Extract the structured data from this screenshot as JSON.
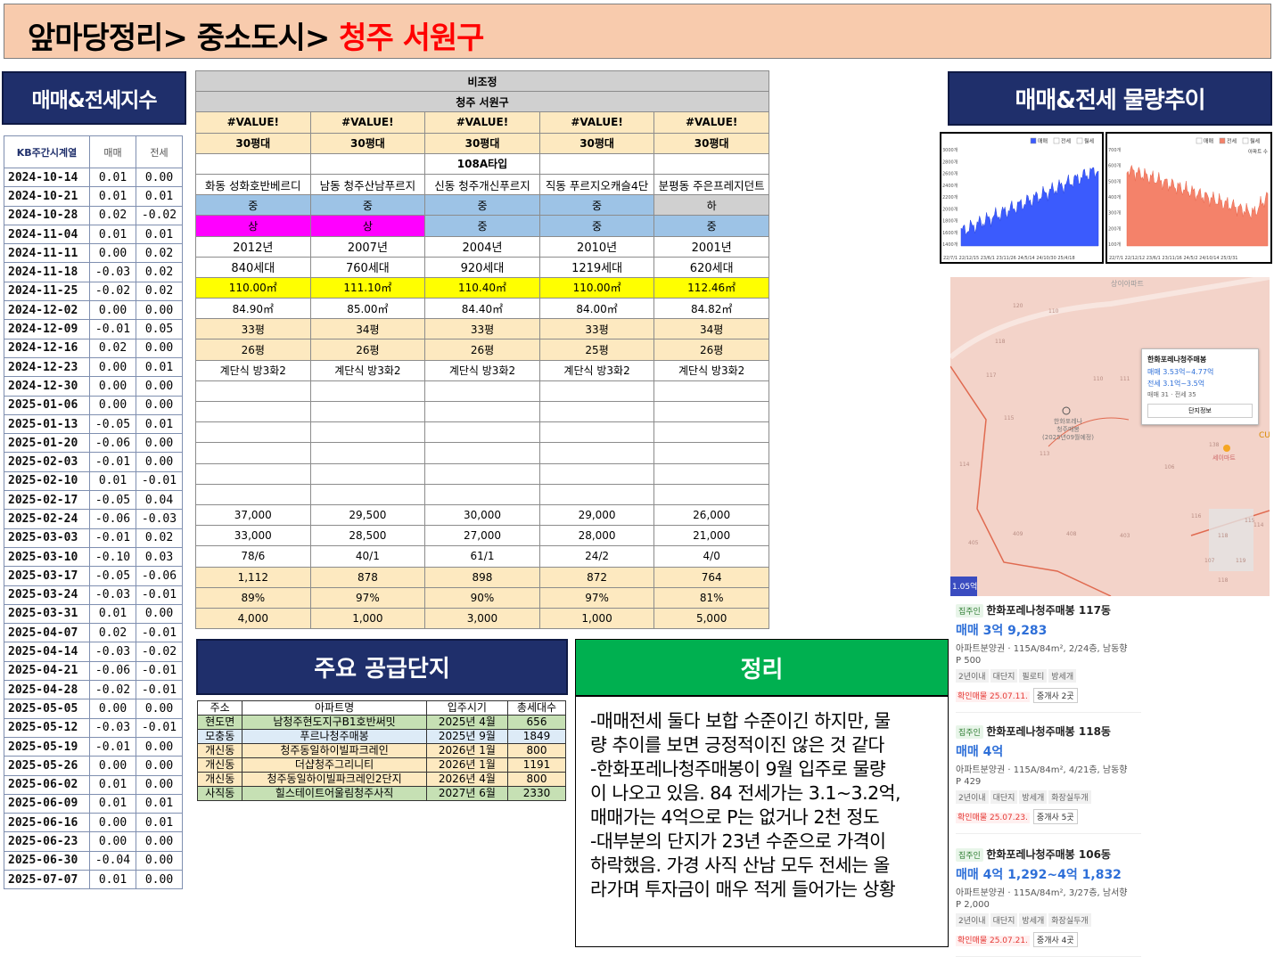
{
  "title": {
    "prefix": "앞마당정리> 중소도시> ",
    "region": "청주 서원구"
  },
  "kb": {
    "header": "매매&전세지수",
    "col_date": "KB주간시계열",
    "col_sale": "매매",
    "col_jeonse": "전세",
    "rows": [
      [
        "2024-10-14",
        "0.01",
        "0.00"
      ],
      [
        "2024-10-21",
        "0.01",
        "0.01"
      ],
      [
        "2024-10-28",
        "0.02",
        "-0.02"
      ],
      [
        "2024-11-04",
        "0.01",
        "0.01"
      ],
      [
        "2024-11-11",
        "0.00",
        "0.02"
      ],
      [
        "2024-11-18",
        "-0.03",
        "0.02"
      ],
      [
        "2024-11-25",
        "-0.02",
        "0.02"
      ],
      [
        "2024-12-02",
        "0.00",
        "0.00"
      ],
      [
        "2024-12-09",
        "-0.01",
        "0.05"
      ],
      [
        "2024-12-16",
        "0.02",
        "0.00"
      ],
      [
        "2024-12-23",
        "0.00",
        "0.01"
      ],
      [
        "2024-12-30",
        "0.00",
        "0.00"
      ],
      [
        "2025-01-06",
        "0.00",
        "0.00"
      ],
      [
        "2025-01-13",
        "-0.05",
        "0.01"
      ],
      [
        "2025-01-20",
        "-0.06",
        "0.00"
      ],
      [
        "2025-02-03",
        "-0.01",
        "0.00"
      ],
      [
        "2025-02-10",
        "0.01",
        "-0.01"
      ],
      [
        "2025-02-17",
        "-0.05",
        "0.04"
      ],
      [
        "2025-02-24",
        "-0.06",
        "-0.03"
      ],
      [
        "2025-03-03",
        "-0.01",
        "0.02"
      ],
      [
        "2025-03-10",
        "-0.10",
        "0.03"
      ],
      [
        "2025-03-17",
        "-0.05",
        "-0.06"
      ],
      [
        "2025-03-24",
        "-0.03",
        "-0.01"
      ],
      [
        "2025-03-31",
        "0.01",
        "0.00"
      ],
      [
        "2025-04-07",
        "0.02",
        "-0.01"
      ],
      [
        "2025-04-14",
        "-0.03",
        "-0.02"
      ],
      [
        "2025-04-21",
        "-0.06",
        "-0.01"
      ],
      [
        "2025-04-28",
        "-0.02",
        "-0.01"
      ],
      [
        "2025-05-05",
        "0.00",
        "0.00"
      ],
      [
        "2025-05-12",
        "-0.03",
        "-0.01"
      ],
      [
        "2025-05-19",
        "-0.01",
        "0.00"
      ],
      [
        "2025-05-26",
        "0.00",
        "0.00"
      ],
      [
        "2025-06-02",
        "0.01",
        "0.00"
      ],
      [
        "2025-06-09",
        "0.01",
        "0.01"
      ],
      [
        "2025-06-16",
        "0.00",
        "0.01"
      ],
      [
        "2025-06-23",
        "0.00",
        "0.00"
      ],
      [
        "2025-06-30",
        "-0.04",
        "0.00"
      ],
      [
        "2025-07-07",
        "0.01",
        "0.00"
      ]
    ]
  },
  "main": {
    "status": "비조정",
    "district": "청주 서원구",
    "value_err": [
      "#VALUE!",
      "#VALUE!",
      "#VALUE!",
      "#VALUE!",
      "#VALUE!"
    ],
    "size": [
      "30평대",
      "30평대",
      "30평대",
      "30평대",
      "30평대"
    ],
    "type": [
      "",
      "",
      "108A타입",
      "",
      ""
    ],
    "names": [
      "화동 성화호반베르디",
      "남동 청주산남푸르지",
      "신동 청주개신푸르지",
      "직동 푸르지오캐슬4단",
      "분평동 주은프레지던트"
    ],
    "grade1": [
      "중",
      "중",
      "중",
      "중",
      "하"
    ],
    "grade2": [
      "상",
      "상",
      "중",
      "중",
      "중"
    ],
    "year": [
      "2012년",
      "2007년",
      "2004년",
      "2010년",
      "2001년"
    ],
    "households": [
      "840세대",
      "760세대",
      "920세대",
      "1219세대",
      "620세대"
    ],
    "supply_area": [
      "110.00㎡",
      "111.10㎡",
      "110.40㎡",
      "110.00㎡",
      "112.46㎡"
    ],
    "exclusive_area": [
      "84.90㎡",
      "85.00㎡",
      "84.40㎡",
      "84.00㎡",
      "84.82㎡"
    ],
    "pyeong": [
      "33평",
      "34평",
      "33평",
      "33평",
      "34평"
    ],
    "ex_pyeong": [
      "26평",
      "26평",
      "26평",
      "25평",
      "26평"
    ],
    "structure": [
      "계단식 방3화2",
      "계단식 방3화2",
      "계단식 방3화2",
      "계단식 방3화2",
      "계단식 방3화2"
    ],
    "sale": [
      "37,000",
      "29,500",
      "30,000",
      "29,000",
      "26,000"
    ],
    "jeonse": [
      "33,000",
      "28,500",
      "27,000",
      "28,000",
      "21,000"
    ],
    "ratio": [
      "78/6",
      "40/1",
      "61/1",
      "24/2",
      "4/0"
    ],
    "count": [
      "1,112",
      "878",
      "898",
      "872",
      "764"
    ],
    "jeonse_rate": [
      "89%",
      "97%",
      "90%",
      "97%",
      "81%"
    ],
    "gap": [
      "4,000",
      "1,000",
      "3,000",
      "1,000",
      "5,000"
    ]
  },
  "supply": {
    "header": "주요 공급단지",
    "cols": [
      "주소",
      "아파트명",
      "입주시기",
      "총세대수"
    ],
    "rows": [
      [
        "현도면",
        "남청주현도지구B1호반써밋",
        "2025년 4월",
        "656"
      ],
      [
        "모충동",
        "푸르나청주매봉",
        "2025년 9월",
        "1849"
      ],
      [
        "개신동",
        "청주동일하이빌파크레인",
        "2026년 1월",
        "800"
      ],
      [
        "개신동",
        "더샵청주그리니티",
        "2026년 1월",
        "1191"
      ],
      [
        "개신동",
        "청주동일하이빌파크레인2단지",
        "2026년 4월",
        "800"
      ],
      [
        "사직동",
        "힐스테이트어울림청주사직",
        "2027년 6월",
        "2330"
      ]
    ],
    "row_colors": [
      "#c6e0b4",
      "#ddebf7",
      "#fde9c0",
      "#fde9c0",
      "#fde9c0",
      "#c6e0b4"
    ]
  },
  "summary": {
    "header": "정리",
    "lines": [
      "-매매전세 둘다 보합 수준이긴 하지만, 물",
      "량 추이를 보면 긍정적이진 않은 것 같다",
      "-한화포레나청주매봉이 9월 입주로 물량",
      "이 나오고 있음. 84 전세가는 3.1~3.2억,",
      "매매가는 4억으로 P는 없거나 2천 정도",
      "-대부분의 단지가 23년 수준으로 가격이",
      "하락했음. 가경 사직 산남 모두 전세는 올",
      "라가며 투자금이 매우 적게 들어가는 상황"
    ]
  },
  "volume": {
    "header": "매매&전세 물량추이",
    "sale_legend": [
      "매매",
      "전세",
      "월세"
    ],
    "rent_legend": [
      "매매",
      "전세",
      "월세"
    ],
    "rent_extra": "아파트 수",
    "sale_ticks": [
      "3000개",
      "2800개",
      "2600개",
      "2400개",
      "2200개",
      "2000개",
      "1800개",
      "1600개",
      "1400개"
    ],
    "rent_ticks": [
      "700개",
      "600개",
      "500개",
      "400개",
      "300개",
      "200개",
      "100개"
    ],
    "sale_x": "22/7/1 22/12/15 23/6/1 23/11/26 24/5/14 24/10/30 25/4/18",
    "rent_x": "22/7/1 22/12/12 23/6/1 23/11/16 24/5/2 24/10/14 25/3/31",
    "colors": {
      "sale": "#3b5bfd",
      "rent": "#f4826a"
    }
  },
  "map": {
    "popup_title": "한화포레나청주매봉",
    "popup_sale": "매매 3.53억~4.77억",
    "popup_jeonse": "전세 3.1억~3.5억",
    "popup_counts": "매매 31 · 전세 35",
    "popup_btn": "단지정보",
    "marker": "한화포레나\n청주매봉\n(2025년09월예정)",
    "corner": "상이아파트",
    "store": "세이마트",
    "price_tag": "1.05억",
    "cu": "CU",
    "numbers": [
      "120",
      "110",
      "118",
      "117",
      "111",
      "115",
      "113",
      "114",
      "106",
      "409",
      "408",
      "403",
      "116",
      "405",
      "118",
      "115",
      "114",
      "107",
      "118",
      "119",
      "140",
      "138",
      "110"
    ]
  },
  "listings": [
    {
      "badge": "집주인",
      "name": "한화포레나청주매봉 117동",
      "price": "매매 3억 9,283",
      "desc": "아파트분양권 · 115A/84m², 2/24층, 남동향",
      "p": "P 500",
      "tags": [
        "2년이내",
        "대단지",
        "필로티",
        "방세개"
      ],
      "confirm": "확인매물 25.07.11.",
      "agents": "중개사 2곳"
    },
    {
      "badge": "집주인",
      "name": "한화포레나청주매봉 118동",
      "price": "매매 4억",
      "desc": "아파트분양권 · 115A/84m², 4/21층, 남동향",
      "p": "P 429",
      "tags": [
        "2년이내",
        "대단지",
        "방세개",
        "화장실두개"
      ],
      "confirm": "확인매물 25.07.23.",
      "agents": "중개사 5곳"
    },
    {
      "badge": "집주인",
      "name": "한화포레나청주매봉 106동",
      "price": "매매 4억 1,292~4억 1,832",
      "desc": "아파트분양권 · 115A/84m², 3/27층, 남서향",
      "p": "P 2,000",
      "tags": [
        "2년이내",
        "대단지",
        "방세개",
        "화장실두개"
      ],
      "confirm": "확인매물 25.07.21.",
      "agents": "중개사 4곳"
    }
  ]
}
